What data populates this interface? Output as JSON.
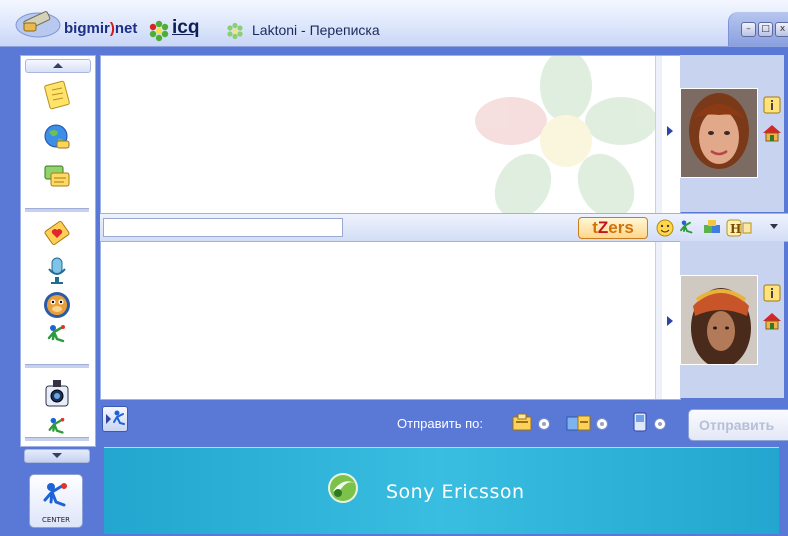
{
  "window": {
    "brand_left": "bigmir",
    "brand_paren": ")",
    "brand_right": "net",
    "icq": "icq",
    "title": "Laktoni - Переписка",
    "btn_min": "–",
    "btn_max": "□",
    "btn_close": "x"
  },
  "sidebar": {
    "icons": [
      "notes-icon",
      "globe-icon",
      "messages-icon",
      "greeting-card-icon",
      "microphone-icon",
      "monkey-icon",
      "xtraz-icon",
      "camera-icon",
      "xtraz-small-icon"
    ],
    "center_label": "CENTER"
  },
  "toolbar": {
    "tzers_t": "t",
    "tzers_z": "Z",
    "tzers_rest": "ers",
    "icons": [
      "smiley-icon",
      "xtraz-icon",
      "puzzle-icon",
      "h-icon"
    ]
  },
  "bottom": {
    "send_by_label": "Отправить по:",
    "send_button": "Отправить",
    "options": [
      "icq-message-icon",
      "multi-message-icon",
      "sms-icon"
    ]
  },
  "banner": {
    "text": "Sony Ericsson"
  },
  "colors": {
    "frame": "#5a78d6",
    "accent": "#2c45a8",
    "banner": "#2ab0d6"
  }
}
